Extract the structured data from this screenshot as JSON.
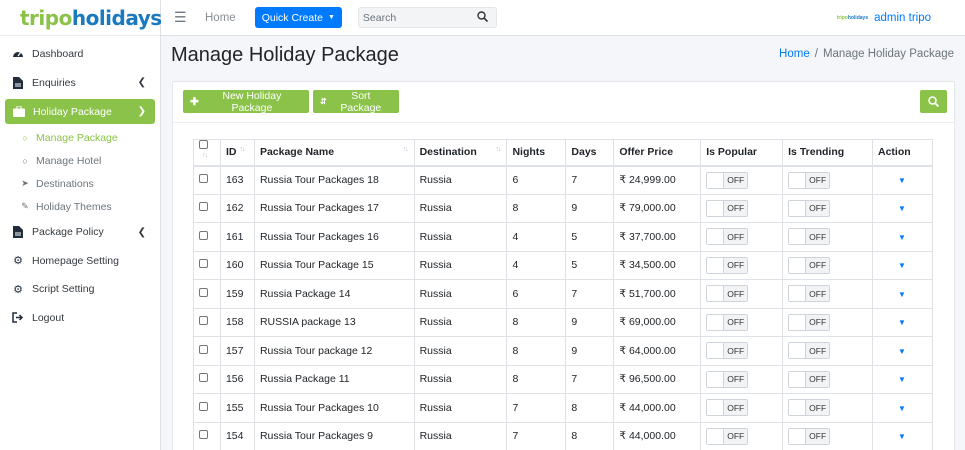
{
  "brand": {
    "part1": "tripo",
    "part2": "holidays"
  },
  "sidebar": {
    "items": [
      {
        "label": "Dashboard"
      },
      {
        "label": "Enquiries"
      },
      {
        "label": "Holiday Package"
      },
      {
        "label": "Package Policy"
      },
      {
        "label": "Homepage Setting"
      },
      {
        "label": "Script Setting"
      },
      {
        "label": "Logout"
      }
    ],
    "submenu": [
      {
        "label": "Manage Package"
      },
      {
        "label": "Manage Hotel"
      },
      {
        "label": "Destinations"
      },
      {
        "label": "Holiday Themes"
      }
    ]
  },
  "topbar": {
    "home": "Home",
    "quick_create": "Quick Create",
    "search_placeholder": "Search",
    "mini_logo_a": "tripo",
    "mini_logo_b": "holidays",
    "user": "admin tripo"
  },
  "page": {
    "title": "Manage Holiday Package",
    "breadcrumb_home": "Home",
    "breadcrumb_sep": "/",
    "breadcrumb_current": "Manage Holiday Package"
  },
  "toolbar": {
    "new_label": "New Holiday Package",
    "sort_label": "Sort Package"
  },
  "table": {
    "headers": [
      "ID",
      "Package Name",
      "Destination",
      "Nights",
      "Days",
      "Offer Price",
      "Is Popular",
      "Is Trending",
      "Action"
    ],
    "toggle_label": "OFF",
    "rows": [
      {
        "id": "163",
        "name": "Russia Tour Packages 18",
        "destination": "Russia",
        "nights": "6",
        "days": "7",
        "price": "₹ 24,999.00"
      },
      {
        "id": "162",
        "name": "Russia Tour Packages 17",
        "destination": "Russia",
        "nights": "8",
        "days": "9",
        "price": "₹ 79,000.00"
      },
      {
        "id": "161",
        "name": "Russia Tour Packages 16",
        "destination": "Russia",
        "nights": "4",
        "days": "5",
        "price": "₹ 37,700.00"
      },
      {
        "id": "160",
        "name": "Russia Tour Package 15",
        "destination": "Russia",
        "nights": "4",
        "days": "5",
        "price": "₹ 34,500.00"
      },
      {
        "id": "159",
        "name": "Russia Package 14",
        "destination": "Russia",
        "nights": "6",
        "days": "7",
        "price": "₹ 51,700.00"
      },
      {
        "id": "158",
        "name": "RUSSIA package 13",
        "destination": "Russia",
        "nights": "8",
        "days": "9",
        "price": "₹ 69,000.00"
      },
      {
        "id": "157",
        "name": "Russia Tour package 12",
        "destination": "Russia",
        "nights": "8",
        "days": "9",
        "price": "₹ 64,000.00"
      },
      {
        "id": "156",
        "name": "Russia Package 11",
        "destination": "Russia",
        "nights": "8",
        "days": "7",
        "price": "₹ 96,500.00"
      },
      {
        "id": "155",
        "name": "Russia Tour Packages 10",
        "destination": "Russia",
        "nights": "7",
        "days": "8",
        "price": "₹ 44,000.00"
      },
      {
        "id": "154",
        "name": "Russia Tour Packages 9",
        "destination": "Russia",
        "nights": "7",
        "days": "8",
        "price": "₹ 44,000.00"
      }
    ]
  }
}
